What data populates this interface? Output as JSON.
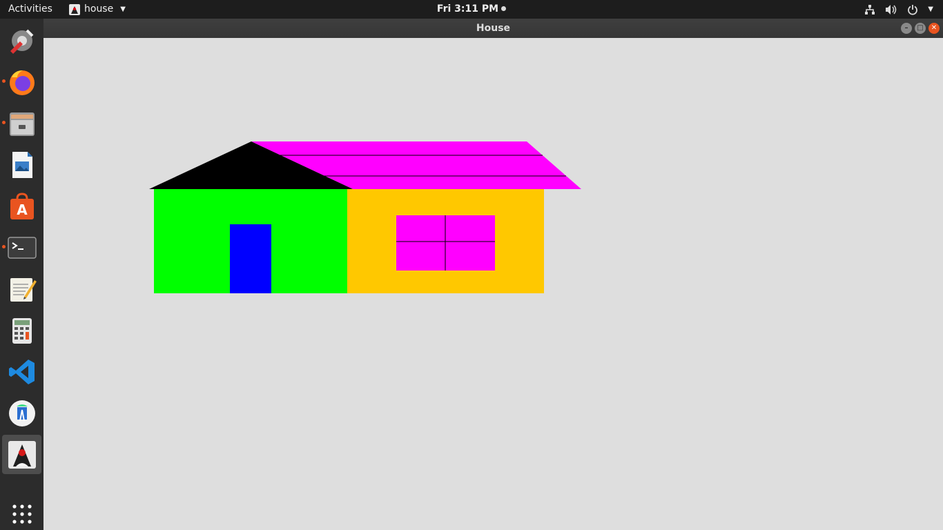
{
  "topbar": {
    "activities_label": "Activities",
    "app_menu_label": "house",
    "clock": "Fri  3:11 PM"
  },
  "icons": {
    "network": "network-icon",
    "volume": "volume-icon",
    "power": "power-icon",
    "caret": "chevron-down-icon"
  },
  "dock": {
    "items": [
      {
        "name": "software-updater-icon",
        "running": false
      },
      {
        "name": "firefox-icon",
        "running": true
      },
      {
        "name": "files-icon",
        "running": true
      },
      {
        "name": "libreoffice-writer-icon",
        "running": false
      },
      {
        "name": "ubuntu-software-icon",
        "running": false
      },
      {
        "name": "terminal-icon",
        "running": true
      },
      {
        "name": "text-editor-icon",
        "running": false
      },
      {
        "name": "calculator-icon",
        "running": false
      },
      {
        "name": "vscode-icon",
        "running": false
      },
      {
        "name": "android-studio-icon",
        "running": false
      },
      {
        "name": "java-duke-icon",
        "running": true
      },
      {
        "name": "show-applications-icon",
        "running": false
      }
    ]
  },
  "window": {
    "title": "House"
  },
  "drawing": {
    "colors": {
      "left_wall": "#00ff00",
      "door": "#0000ff",
      "right_wall": "#ffc800",
      "window": "#ff00ff",
      "roof_side": "#ff00ff",
      "gable": "#000000",
      "accent": "#e95420"
    }
  }
}
